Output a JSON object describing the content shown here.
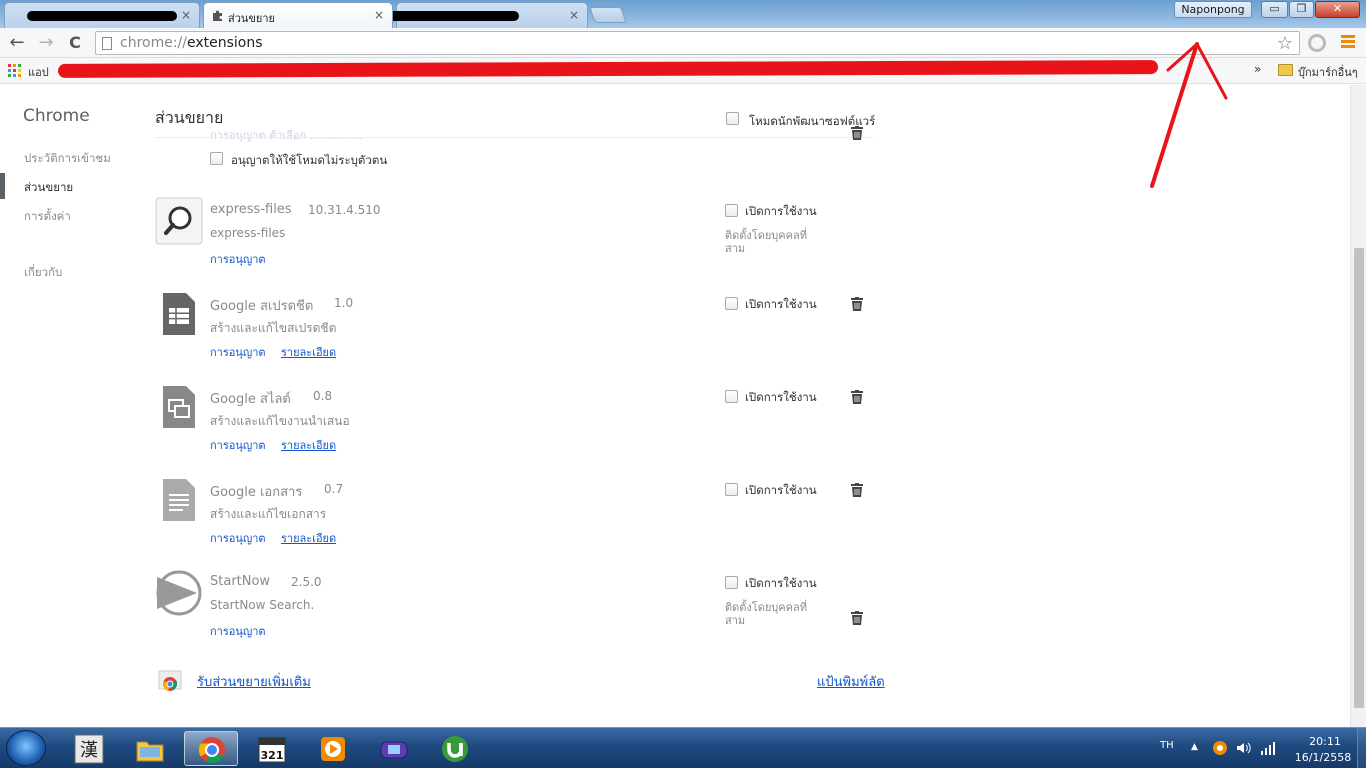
{
  "window": {
    "tabs": [
      {
        "label": "",
        "redacted": true
      },
      {
        "label": "ส่วนขยาย",
        "icon": "puzzle-icon",
        "active": true
      },
      {
        "label": "",
        "redacted": true
      }
    ],
    "user_name": "Naponpong",
    "close_glyph": "×",
    "minimize_glyph": "▭",
    "maximize_glyph": "❐",
    "window_close_glyph": "✕"
  },
  "toolbar": {
    "back_glyph": "←",
    "forward_glyph": "→",
    "reload_glyph": "C",
    "url_scheme": "chrome://",
    "url_rest": "extensions",
    "star_glyph": "☆"
  },
  "bookmarks": {
    "apps_label": "แอป",
    "overflow_glyph": "»",
    "other_bookmarks": "บุ๊กมาร์กอื่นๆ"
  },
  "sidebar": {
    "title": "Chrome",
    "items": [
      {
        "label": "ประวัติการเข้าชม",
        "selected": false
      },
      {
        "label": "ส่วนขยาย",
        "selected": true
      },
      {
        "label": "การตั้งค่า",
        "selected": false
      },
      {
        "label": "เกี่ยวกับ",
        "selected": false
      }
    ]
  },
  "main": {
    "title": "ส่วนขยาย",
    "dev_mode_label": "โหมดนักพัฒนาซอฟต์แวร์",
    "dev_mode_checked": false,
    "incognito_label": "อนุญาตให้ใช้โหมดไม่ระบุตัวตน",
    "ghost_links": "การอนุญาต    ตัวเลือก    ..............."
  },
  "extensions": [
    {
      "name": "express-files",
      "version": "10.31.4.510",
      "description": "express-files",
      "icon": "magnifier-icon",
      "links": [
        "การอนุญาต"
      ],
      "enable_label": "เปิดการใช้งาน",
      "enabled": false,
      "third_party_note": "ติดตั้งโดยบุคคลที่สาม"
    },
    {
      "name": "Google สเปรดชีต",
      "version": "1.0",
      "description": "สร้างและแก้ไขสเปรดชีต",
      "icon": "sheets-icon",
      "links": [
        "การอนุญาต",
        "รายละเอียด"
      ],
      "enable_label": "เปิดการใช้งาน",
      "enabled": false
    },
    {
      "name": "Google สไลด์",
      "version": "0.8",
      "description": "สร้างและแก้ไขงานนำเสนอ",
      "icon": "slides-icon",
      "links": [
        "การอนุญาต",
        "รายละเอียด"
      ],
      "enable_label": "เปิดการใช้งาน",
      "enabled": false
    },
    {
      "name": "Google เอกสาร",
      "version": "0.7",
      "description": "สร้างและแก้ไขเอกสาร",
      "icon": "docs-icon",
      "links": [
        "การอนุญาต",
        "รายละเอียด"
      ],
      "enable_label": "เปิดการใช้งาน",
      "enabled": false
    },
    {
      "name": "StartNow",
      "version": "2.5.0",
      "description": "StartNow Search.",
      "icon": "play-icon",
      "links": [
        "การอนุญาต"
      ],
      "enable_label": "เปิดการใช้งาน",
      "enabled": false,
      "third_party_note": "ติดตั้งโดยบุคคลที่สาม"
    }
  ],
  "footer": {
    "get_more": "รับส่วนขยายเพิ่มเติม",
    "shortcuts": "แป้นพิมพ์ลัด"
  },
  "taskbar": {
    "apps": [
      "kanji-icon",
      "explorer-icon",
      "chrome-icon",
      "calendar-icon",
      "media-player-icon",
      "emulator-icon",
      "utorrent-icon"
    ],
    "language": "TH",
    "tray_up_glyph": "▲",
    "time": "20:11",
    "date": "16/1/2558",
    "calendar_label": "321"
  },
  "colors": {
    "link": "#1155cc",
    "redaction": "#e8141a",
    "menu_orange": "#f08a00"
  }
}
